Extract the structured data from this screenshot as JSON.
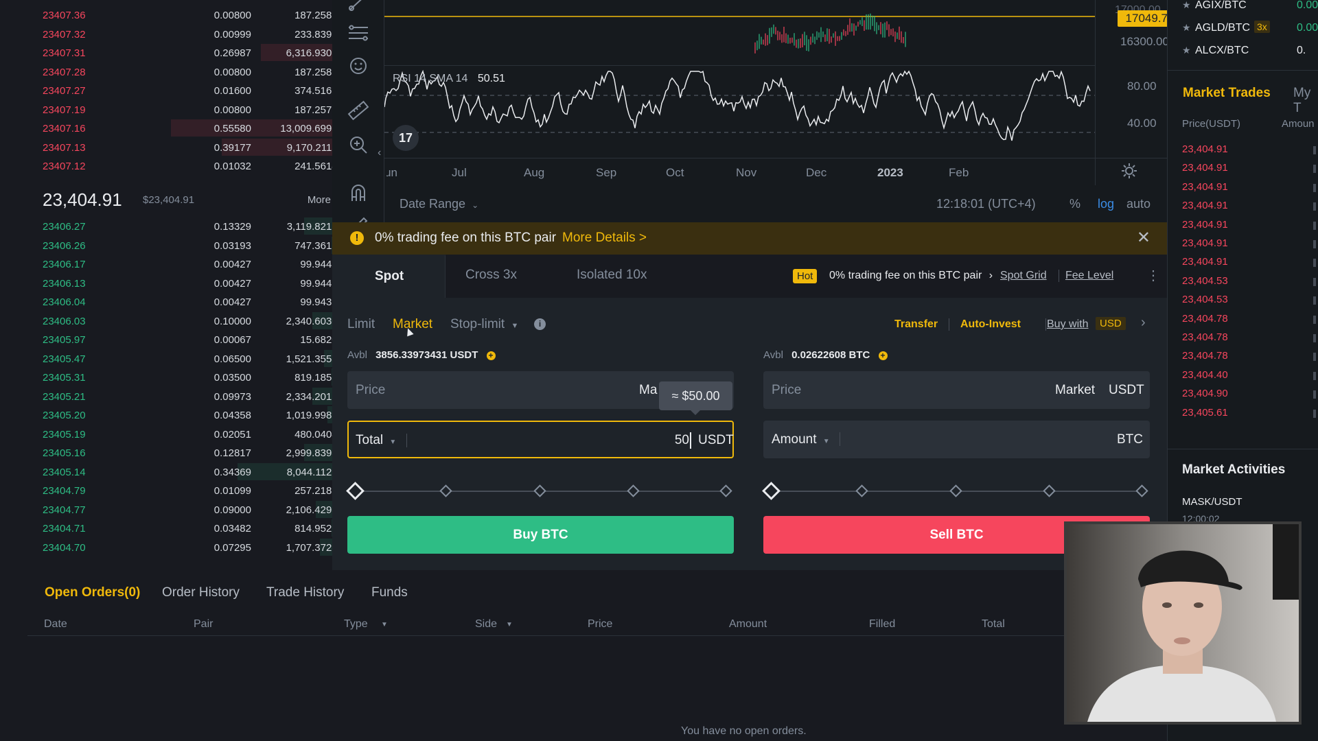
{
  "orderbook": {
    "asks": [
      {
        "price": "23407.36",
        "amount": "0.00800",
        "total": "187.25888",
        "depth": 0.04
      },
      {
        "price": "23407.32",
        "amount": "0.00999",
        "total": "233.83913",
        "depth": 0.04
      },
      {
        "price": "23407.31",
        "amount": "0.26987",
        "total": "6,316.93075",
        "depth": 0.44
      },
      {
        "price": "23407.28",
        "amount": "0.00800",
        "total": "187.25824",
        "depth": 0.04
      },
      {
        "price": "23407.27",
        "amount": "0.01600",
        "total": "374.51632",
        "depth": 0.06
      },
      {
        "price": "23407.19",
        "amount": "0.00800",
        "total": "187.25752",
        "depth": 0.04
      },
      {
        "price": "23407.16",
        "amount": "0.55580",
        "total": "13,009.69953",
        "depth": 0.9
      },
      {
        "price": "23407.13",
        "amount": "0.39177",
        "total": "9,170.21132",
        "depth": 0.64
      },
      {
        "price": "23407.12",
        "amount": "0.01032",
        "total": "241.56148",
        "depth": 0.04
      }
    ],
    "last_price": "23,404.91",
    "last_price_usd": "$23,404.91",
    "more_label": "More",
    "bids": [
      {
        "price": "23406.27",
        "amount": "0.13329",
        "total": "3,119.82173",
        "depth": 0.22
      },
      {
        "price": "23406.26",
        "amount": "0.03193",
        "total": "747.36188",
        "depth": 0.08
      },
      {
        "price": "23406.17",
        "amount": "0.00427",
        "total": "99.94435",
        "depth": 0.02
      },
      {
        "price": "23406.13",
        "amount": "0.00427",
        "total": "99.94418",
        "depth": 0.02
      },
      {
        "price": "23406.04",
        "amount": "0.00427",
        "total": "99.94379",
        "depth": 0.02
      },
      {
        "price": "23406.03",
        "amount": "0.10000",
        "total": "2,340.60300",
        "depth": 0.18
      },
      {
        "price": "23405.97",
        "amount": "0.00067",
        "total": "15.68200",
        "depth": 0.01
      },
      {
        "price": "23405.47",
        "amount": "0.06500",
        "total": "1,521.35555",
        "depth": 0.12
      },
      {
        "price": "23405.31",
        "amount": "0.03500",
        "total": "819.18585",
        "depth": 0.08
      },
      {
        "price": "23405.21",
        "amount": "0.09973",
        "total": "2,334.20159",
        "depth": 0.18
      },
      {
        "price": "23405.20",
        "amount": "0.04358",
        "total": "1,019.99862",
        "depth": 0.1
      },
      {
        "price": "23405.19",
        "amount": "0.02051",
        "total": "480.04045",
        "depth": 0.05
      },
      {
        "price": "23405.16",
        "amount": "0.12817",
        "total": "2,999.83936",
        "depth": 0.22
      },
      {
        "price": "23405.14",
        "amount": "0.34369",
        "total": "8,044.11257",
        "depth": 0.56
      },
      {
        "price": "23404.79",
        "amount": "0.01099",
        "total": "257.21864",
        "depth": 0.04
      },
      {
        "price": "23404.77",
        "amount": "0.09000",
        "total": "2,106.42930",
        "depth": 0.16
      },
      {
        "price": "23404.71",
        "amount": "0.03482",
        "total": "814.95200",
        "depth": 0.08
      },
      {
        "price": "23404.70",
        "amount": "0.07295",
        "total": "1,707.37287",
        "depth": 0.14
      }
    ]
  },
  "chart": {
    "price_marker": "17049.72",
    "price_axis": [
      "17000.00",
      "16300.00"
    ],
    "rsi_label": "RSI 14 SMA 14",
    "rsi_value": "50.51",
    "rsi_axis": [
      "80.00",
      "40.00"
    ],
    "months": [
      "Jun",
      "Jul",
      "Aug",
      "Sep",
      "Oct",
      "Nov",
      "Dec",
      "2023",
      "Feb"
    ],
    "date_range": "Date Range",
    "clock": "12:18:01 (UTC+4)",
    "scale_pct": "%",
    "scale_log": "log",
    "scale_auto": "auto",
    "logo": "17"
  },
  "notice": {
    "text": "0% trading fee on this BTC pair",
    "link": "More Details >"
  },
  "trade": {
    "tabs": [
      "Spot",
      "Cross 3x",
      "Isolated 10x"
    ],
    "hot_badge": "Hot",
    "hot_text": "0% trading fee on this BTC pair",
    "spot_grid": "Spot Grid",
    "fee_level": "Fee Level",
    "order_types": [
      "Limit",
      "Market",
      "Stop-limit"
    ],
    "transfer": "Transfer",
    "auto_invest": "Auto-Invest",
    "buy_with": "Buy with",
    "buy_with_currency": "USD",
    "buy": {
      "avbl_label": "Avbl",
      "avbl_value": "3856.33973431 USDT",
      "price_label": "Price",
      "price_value": "Ma",
      "tooltip": "≈ $50.00",
      "total_label": "Total",
      "total_value": "50",
      "total_unit": "USDT",
      "button": "Buy BTC"
    },
    "sell": {
      "avbl_label": "Avbl",
      "avbl_value": "0.02622608 BTC",
      "price_label": "Price",
      "price_value": "Market",
      "price_unit": "USDT",
      "amount_label": "Amount",
      "amount_unit": "BTC",
      "button": "Sell BTC"
    }
  },
  "orders": {
    "tabs": [
      "Open Orders(0)",
      "Order History",
      "Trade History",
      "Funds"
    ],
    "columns": [
      "Date",
      "Pair",
      "Type",
      "Side",
      "Price",
      "Amount",
      "Filled",
      "Total"
    ],
    "empty": "You have no open orders."
  },
  "right": {
    "pairs": [
      {
        "name": "AGIX/BTC",
        "change": "0.00"
      },
      {
        "name": "AGLD/BTC",
        "badge": "3x",
        "change": "0.00"
      },
      {
        "name": "ALCX/BTC",
        "change": "0."
      }
    ],
    "trades_tabs": [
      "Market Trades",
      "My T"
    ],
    "trades_cols": [
      "Price(USDT)",
      "Amoun"
    ],
    "trades": [
      "23,404.91",
      "23,404.91",
      "23,404.91",
      "23,404.91",
      "23,404.91",
      "23,404.91",
      "23,404.91",
      "23,404.53",
      "23,404.53",
      "23,404.78",
      "23,404.78",
      "23,404.78",
      "23,404.40",
      "23,404.90",
      "23,405.61"
    ],
    "activities_title": "Market Activities",
    "activity_pair": "MASK/USDT",
    "activity_time": "12:00:02"
  },
  "colors": {
    "red": "#f6465d",
    "green": "#2ebd85",
    "yellow": "#f0b90b",
    "bg": "#181a20",
    "panel": "#1e2329"
  }
}
